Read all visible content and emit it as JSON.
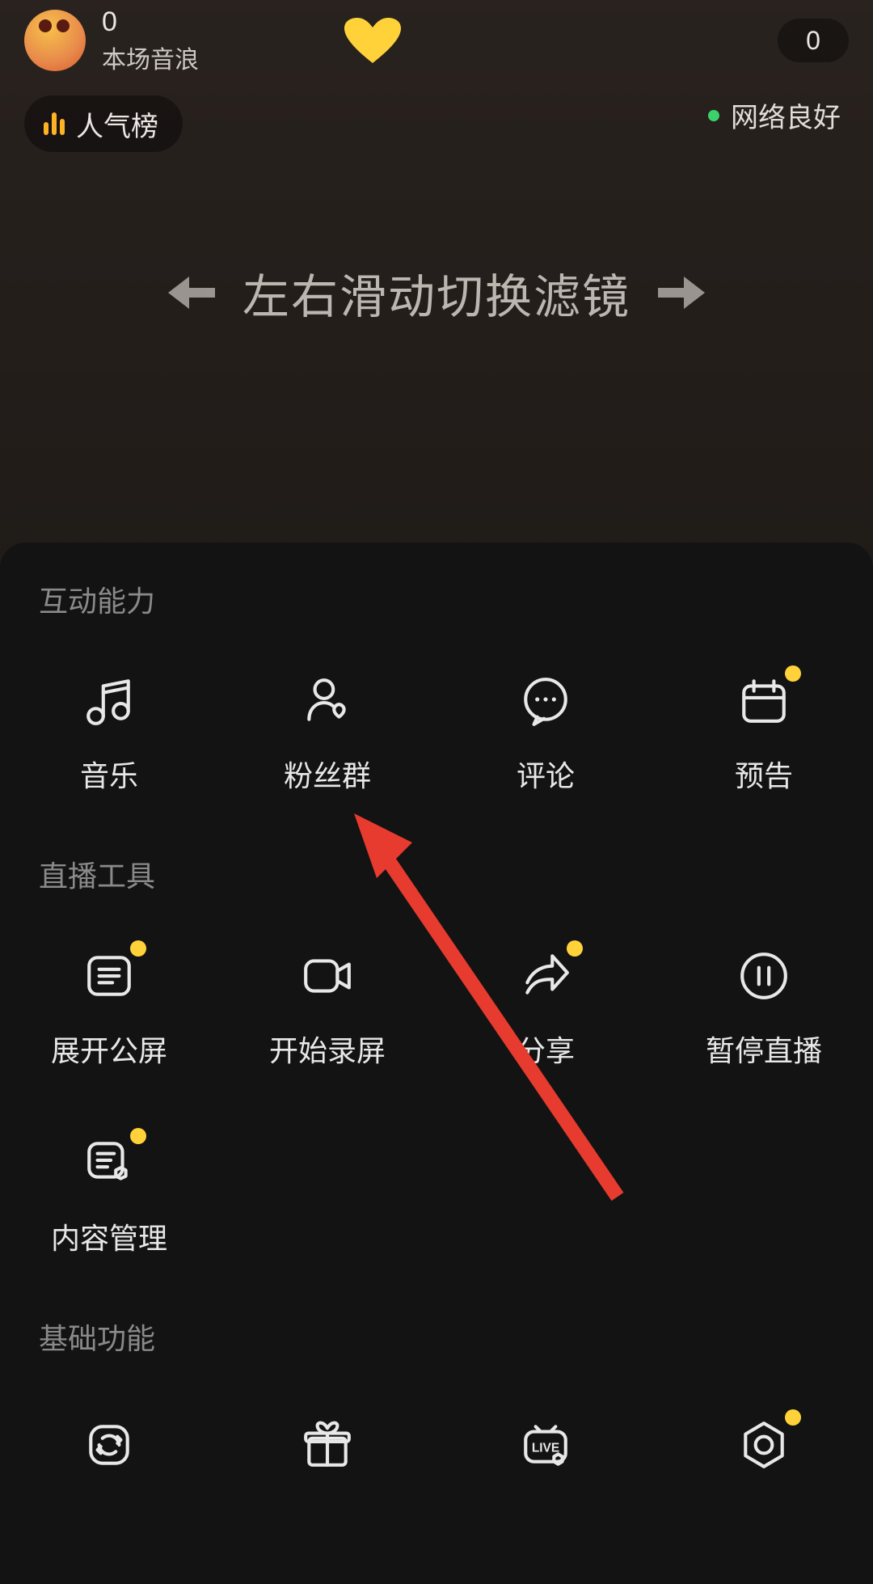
{
  "hud": {
    "wave_count": "0",
    "wave_label": "本场音浪",
    "right_count": "0",
    "popularity_label": "人气榜",
    "network_label": "网络良好"
  },
  "swipe_hint": "左右滑动切换滤镜",
  "sections": {
    "interact": {
      "title": "互动能力",
      "items": {
        "music": {
          "label": "音乐",
          "icon": "music",
          "badge": false
        },
        "fan_group": {
          "label": "粉丝群",
          "icon": "fan-group",
          "badge": false
        },
        "comment": {
          "label": "评论",
          "icon": "comment",
          "badge": false
        },
        "schedule": {
          "label": "预告",
          "icon": "calendar",
          "badge": true
        }
      }
    },
    "tools": {
      "title": "直播工具",
      "items": {
        "expand_screen": {
          "label": "展开公屏",
          "icon": "list",
          "badge": true
        },
        "record": {
          "label": "开始录屏",
          "icon": "camera",
          "badge": false
        },
        "share": {
          "label": "分享",
          "icon": "share",
          "badge": true
        },
        "pause": {
          "label": "暂停直播",
          "icon": "pause",
          "badge": false
        },
        "content_mgmt": {
          "label": "内容管理",
          "icon": "content",
          "badge": true
        }
      }
    },
    "basic": {
      "title": "基础功能",
      "items": {
        "flip": {
          "label": "",
          "icon": "flip",
          "badge": false
        },
        "gift": {
          "label": "",
          "icon": "gift",
          "badge": false
        },
        "live_set": {
          "label": "",
          "icon": "live-set",
          "badge": false
        },
        "settings": {
          "label": "",
          "icon": "gear",
          "badge": true
        }
      }
    }
  },
  "colors": {
    "accent": "#ffd23a",
    "good": "#3cd26b"
  }
}
